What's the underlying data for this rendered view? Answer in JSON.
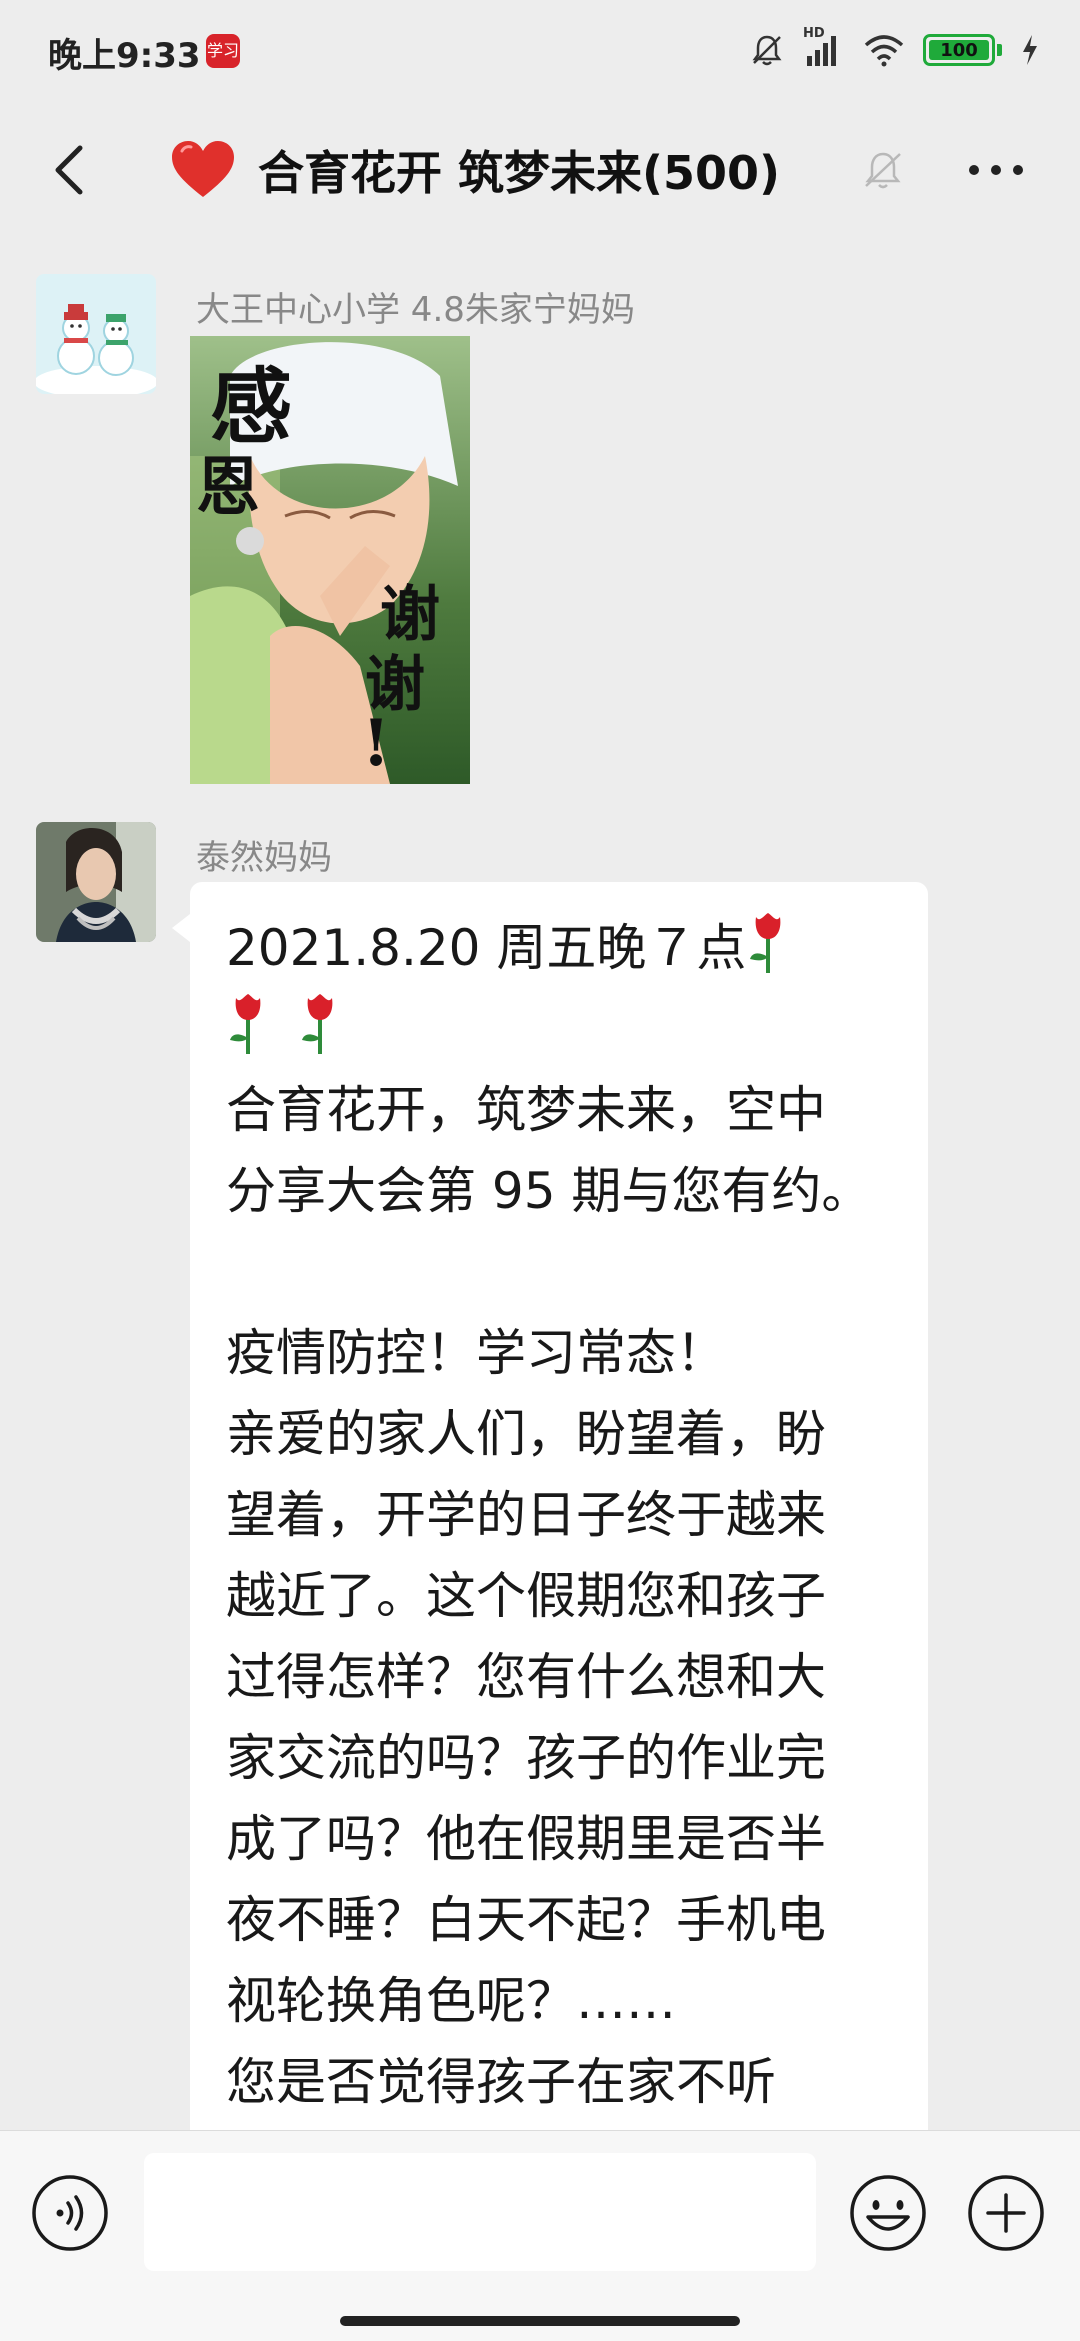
{
  "status_bar": {
    "time": "晚上9:33",
    "app_icon_label": "学习",
    "network_badge": "HD",
    "battery_level": "100",
    "icons": [
      "mute-bell-icon",
      "signal-icon",
      "wifi-icon",
      "battery-icon",
      "charging-icon"
    ]
  },
  "header": {
    "title": "合育花开 筑梦未来(500)",
    "icons": [
      "back-icon",
      "heart-icon",
      "mute-icon",
      "more-icon"
    ]
  },
  "messages": [
    {
      "sender": "大王中心小学 4.8朱家宁妈妈",
      "type": "sticker",
      "sticker": {
        "line1": "感",
        "line2": "恩",
        "line3": "谢",
        "line4": "谢",
        "line5": "!"
      }
    },
    {
      "sender": "泰然妈妈",
      "type": "text",
      "lines": [
        "2021.8.20  周五晚７点",
        "",
        "合育花开，筑梦未来，空中",
        "分享大会第 95 期与您有约。",
        "",
        "疫情防控！学习常态！",
        "亲爱的家人们，盼望着，盼",
        "望着，开学的日子终于越来",
        "越近了。这个假期您和孩子",
        "过得怎样？您有什么想和大",
        "家交流的吗？孩子的作业完",
        "成了吗？他在假期里是否半",
        "夜不睡？白天不起？手机电",
        "视轮换角色呢？……",
        "您是否觉得孩子在家不听"
      ]
    }
  ],
  "input_bar": {
    "placeholder": "",
    "icons": [
      "voice-icon",
      "emoji-icon",
      "plus-icon"
    ]
  },
  "colors": {
    "background": "#EDEDED",
    "bubble": "#FFFFFF",
    "heart": "#E0302C",
    "battery": "#1FAA3A"
  }
}
